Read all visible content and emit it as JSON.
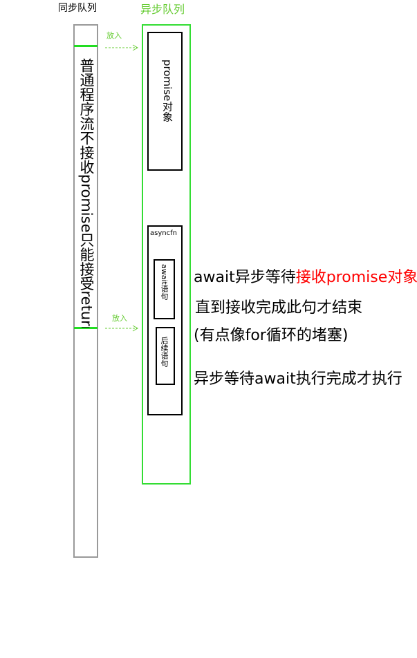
{
  "headers": {
    "sync_queue": "同步队列",
    "async_queue": "异步队列"
  },
  "sync_column": {
    "text": "普通程序流不接收promise只能接受return"
  },
  "arrows": {
    "put_in_1": "放入",
    "put_in_2": "放入"
  },
  "async_column": {
    "promise_box": "promise对象",
    "asyncfn_label": "asyncfn",
    "await_box": "await语句",
    "after_box": "后续语句"
  },
  "notes": {
    "line1_black": "await异步等待",
    "line1_red": "接收promise对象",
    "line2": "直到接收完成此句才结束",
    "line3": "(有点像for循环的堵塞)",
    "line4": "异步等待await执行完成才执行"
  },
  "colors": {
    "green_header": "#66cc33",
    "green_border": "#33dd33",
    "gray_border": "#999999",
    "red_highlight": "#ff0000"
  }
}
